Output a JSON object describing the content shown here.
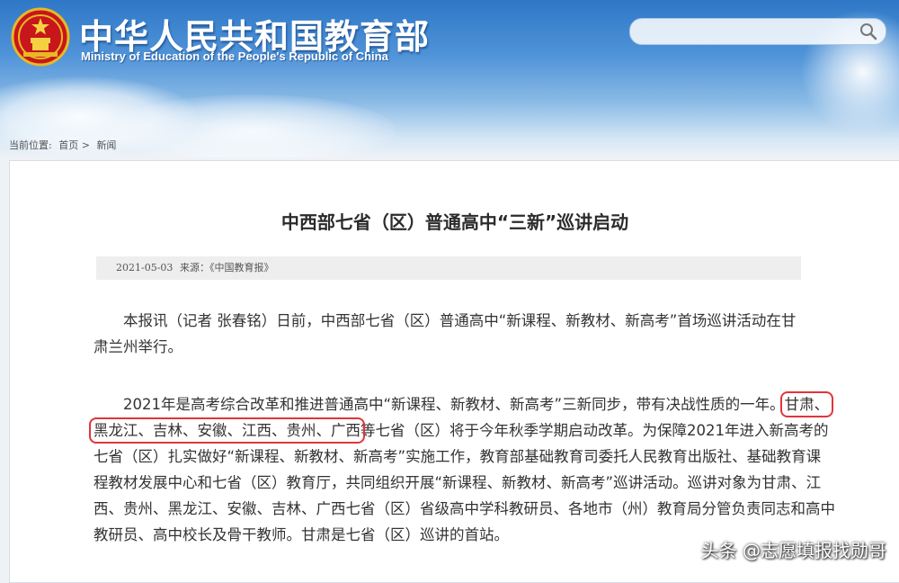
{
  "header": {
    "title_cn": "中华人民共和国教育部",
    "title_en": "Ministry of Education of the People's Republic of China",
    "search": {
      "value": "",
      "placeholder": ""
    }
  },
  "breadcrumb": {
    "prefix": "当前位置:",
    "home": "首页",
    "separator": ">",
    "current": "新闻"
  },
  "article": {
    "title": "中西部七省（区）普通高中“三新”巡讲启动",
    "date": "2021-05-03",
    "source": "来源：《中国教育报》",
    "paragraph1": "本报讯（记者 张春铭）日前，中西部七省（区）普通高中“新课程、新教材、新高考”首场巡讲活动在甘肃兰州举行。",
    "paragraph2": {
      "l1_text": "2021年是高考综合改革和推进普通高中“新课程、新教材、新高考”三新同步，带有决战性质的一年。",
      "l1_hl": "甘肃、",
      "l2_hl": "黑龙江、吉林、安徽、江西、贵州、广西",
      "l2_text": "等七省（区）将于今年秋季学期启动改革。为保障2021年进入新高考的",
      "l3": "七省（区）扎实做好“新课程、新教材、新高考”实施工作，教育部基础教育司委托人民教育出版社、基础教育课",
      "l4": "程教材发展中心和七省（区）教育厅，共同组织开展“新课程、新教材、新高考”巡讲活动。巡讲对象为甘肃、江",
      "l5": "西、贵州、黑龙江、安徽、吉林、广西七省（区）省级高中学科教研员、各地市（州）教育局分管负责同志和高中",
      "l6": "教研员、高中校长及骨干教师。甘肃是七省（区）巡讲的首站。"
    }
  },
  "watermark": "头条 @志愿填报找勋哥",
  "colors": {
    "highlight": "#e0353b",
    "header_blue": "#2f78c7"
  },
  "icons": {
    "emblem": "national-emblem-icon",
    "search": "search-icon"
  }
}
